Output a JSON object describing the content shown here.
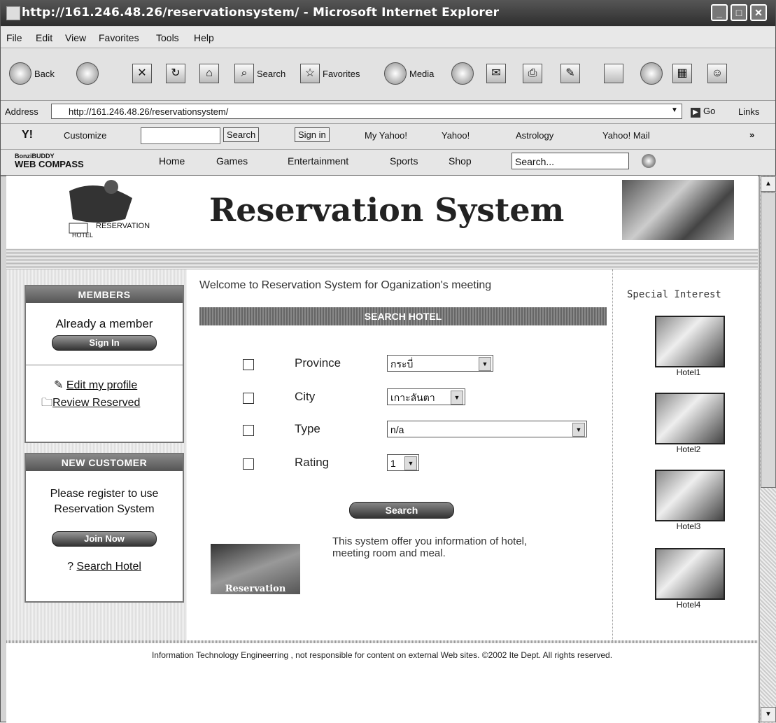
{
  "window": {
    "title": "http://161.246.48.26/reservationsystem/ - Microsoft Internet Explorer"
  },
  "menu": [
    "File",
    "Edit",
    "View",
    "Favorites",
    "Tools",
    "Help"
  ],
  "toolbar": {
    "back": "Back",
    "search": "Search",
    "favorites": "Favorites",
    "media": "Media"
  },
  "address": {
    "label": "Address",
    "url": "http://161.246.48.26/reservationsystem/",
    "go": "Go",
    "links": "Links"
  },
  "yahoo_toolbar": {
    "customize": "Customize",
    "search_btn": "Search",
    "sign_in": "Sign in",
    "my_yahoo": "My Yahoo!",
    "yahoo": "Yahoo!",
    "astrology": "Astrology",
    "mail": "Yahoo! Mail"
  },
  "bonzi_toolbar": {
    "brand_top": "BonziBUDDY",
    "brand_bottom": "WEB COMPASS",
    "home": "Home",
    "games": "Games",
    "entertainment": "Entertainment",
    "sports": "Sports",
    "shop": "Shop",
    "search_placeholder": "Search..."
  },
  "page": {
    "logo_text_1": "RESERVATION",
    "logo_text_2": "HOTEL",
    "title": "Reservation System",
    "members": {
      "header": "MEMBERS",
      "text": "Already a member",
      "sign_in": "Sign In",
      "edit_profile": "Edit my profile",
      "review": "Review Reserved"
    },
    "new_customer": {
      "header": "NEW CUSTOMER",
      "text": "Please register to use Reservation System",
      "join": "Join Now",
      "search_hotel": "Search Hotel"
    },
    "welcome": "Welcome to  Reservation System for Oganization's meeting",
    "search_header": "SEARCH HOTEL",
    "fields": [
      {
        "label": "Province",
        "value": "กระบี่"
      },
      {
        "label": "City",
        "value": "เกาะลันตา"
      },
      {
        "label": "Type",
        "value": "n/a"
      },
      {
        "label": "Rating",
        "value": "1"
      }
    ],
    "search_button": "Search",
    "reservation_img_text": "Reservation",
    "blurb": "This system offer you information of hotel, meeting room and meal.",
    "special_interest": "Special Interest",
    "hotels": [
      "Hotel1",
      "Hotel2",
      "Hotel3",
      "Hotel4"
    ],
    "footer": "Information Technology Engineerring , not responsible for content on external Web sites. ©2002 Ite Dept. All rights reserved."
  }
}
